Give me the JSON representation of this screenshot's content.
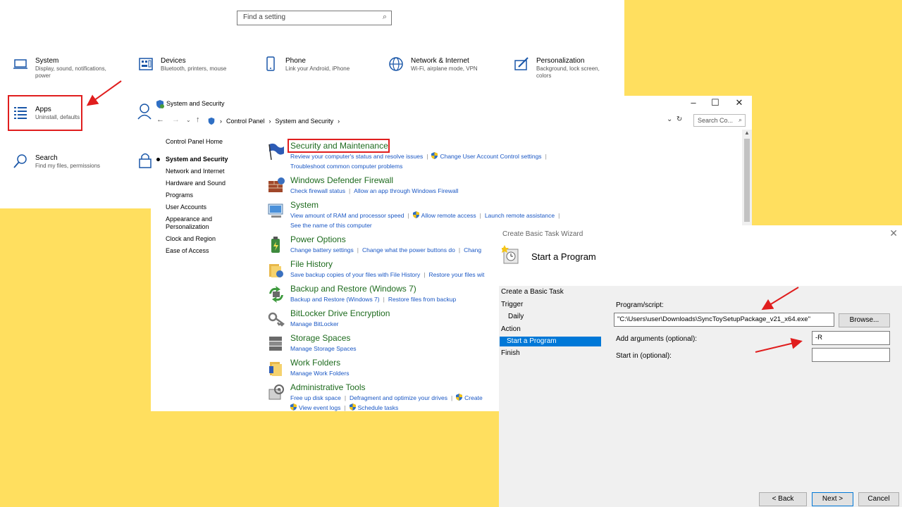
{
  "settings": {
    "search_placeholder": "Find a setting",
    "tiles": [
      {
        "title": "System",
        "desc": "Display, sound, notifications, power"
      },
      {
        "title": "Devices",
        "desc": "Bluetooth, printers, mouse"
      },
      {
        "title": "Phone",
        "desc": "Link your Android, iPhone"
      },
      {
        "title": "Network & Internet",
        "desc": "Wi-Fi, airplane mode, VPN"
      },
      {
        "title": "Personalization",
        "desc": "Background, lock screen, colors"
      },
      {
        "title": "Apps",
        "desc": "Uninstall, defaults"
      },
      {
        "title": "Search",
        "desc": "Find my files, permissions"
      }
    ]
  },
  "control_panel": {
    "title": "System and Security",
    "breadcrumb": [
      "Control Panel",
      "System and Security"
    ],
    "search_placeholder": "Search Co...",
    "left_nav": {
      "home": "Control Panel Home",
      "items": [
        "System and Security",
        "Network and Internet",
        "Hardware and Sound",
        "Programs",
        "User Accounts",
        "Appearance and Personalization",
        "Clock and Region",
        "Ease of Access"
      ]
    },
    "categories": [
      {
        "title": "Security and Maintenance",
        "lines": [
          [
            "Review your computer's status and resolve issues",
            "Change User Account Control settings"
          ],
          [
            "Troubleshoot common computer problems"
          ]
        ]
      },
      {
        "title": "Windows Defender Firewall",
        "lines": [
          [
            "Check firewall status",
            "Allow an app through Windows Firewall"
          ]
        ]
      },
      {
        "title": "System",
        "lines": [
          [
            "View amount of RAM and processor speed",
            "Allow remote access",
            "Launch remote assistance"
          ],
          [
            "See the name of this computer"
          ]
        ]
      },
      {
        "title": "Power Options",
        "lines": [
          [
            "Change battery settings",
            "Change what the power buttons do",
            "Chang"
          ]
        ]
      },
      {
        "title": "File History",
        "lines": [
          [
            "Save backup copies of your files with File History",
            "Restore your files wit"
          ]
        ]
      },
      {
        "title": "Backup and Restore (Windows 7)",
        "lines": [
          [
            "Backup and Restore (Windows 7)",
            "Restore files from backup"
          ]
        ]
      },
      {
        "title": "BitLocker Drive Encryption",
        "lines": [
          [
            "Manage BitLocker"
          ]
        ]
      },
      {
        "title": "Storage Spaces",
        "lines": [
          [
            "Manage Storage Spaces"
          ]
        ]
      },
      {
        "title": "Work Folders",
        "lines": [
          [
            "Manage Work Folders"
          ]
        ]
      },
      {
        "title": "Administrative Tools",
        "lines": [
          [
            "Free up disk space",
            "Defragment and optimize your drives",
            "Create"
          ],
          [
            "View event logs",
            "Schedule tasks"
          ]
        ]
      }
    ]
  },
  "wizard": {
    "window_title": "Create Basic Task Wizard",
    "header_title": "Start a Program",
    "steps": [
      "Create a Basic Task",
      "Trigger",
      "Daily",
      "Action",
      "Start a Program",
      "Finish"
    ],
    "program_label": "Program/script:",
    "program_value": "\"C:\\Users\\user\\Downloads\\SyncToySetupPackage_v21_x64.exe\"",
    "browse_label": "Browse...",
    "args_label": "Add arguments (optional):",
    "args_value": "-R",
    "startin_label": "Start in (optional):",
    "startin_value": "",
    "back_label": "< Back",
    "next_label": "Next >",
    "cancel_label": "Cancel"
  },
  "colors": {
    "highlight": "#e01e1e",
    "link": "#1a57c4",
    "category_title": "#1e6b1e",
    "background": "#FFDF5F",
    "selection": "#0078d7"
  }
}
